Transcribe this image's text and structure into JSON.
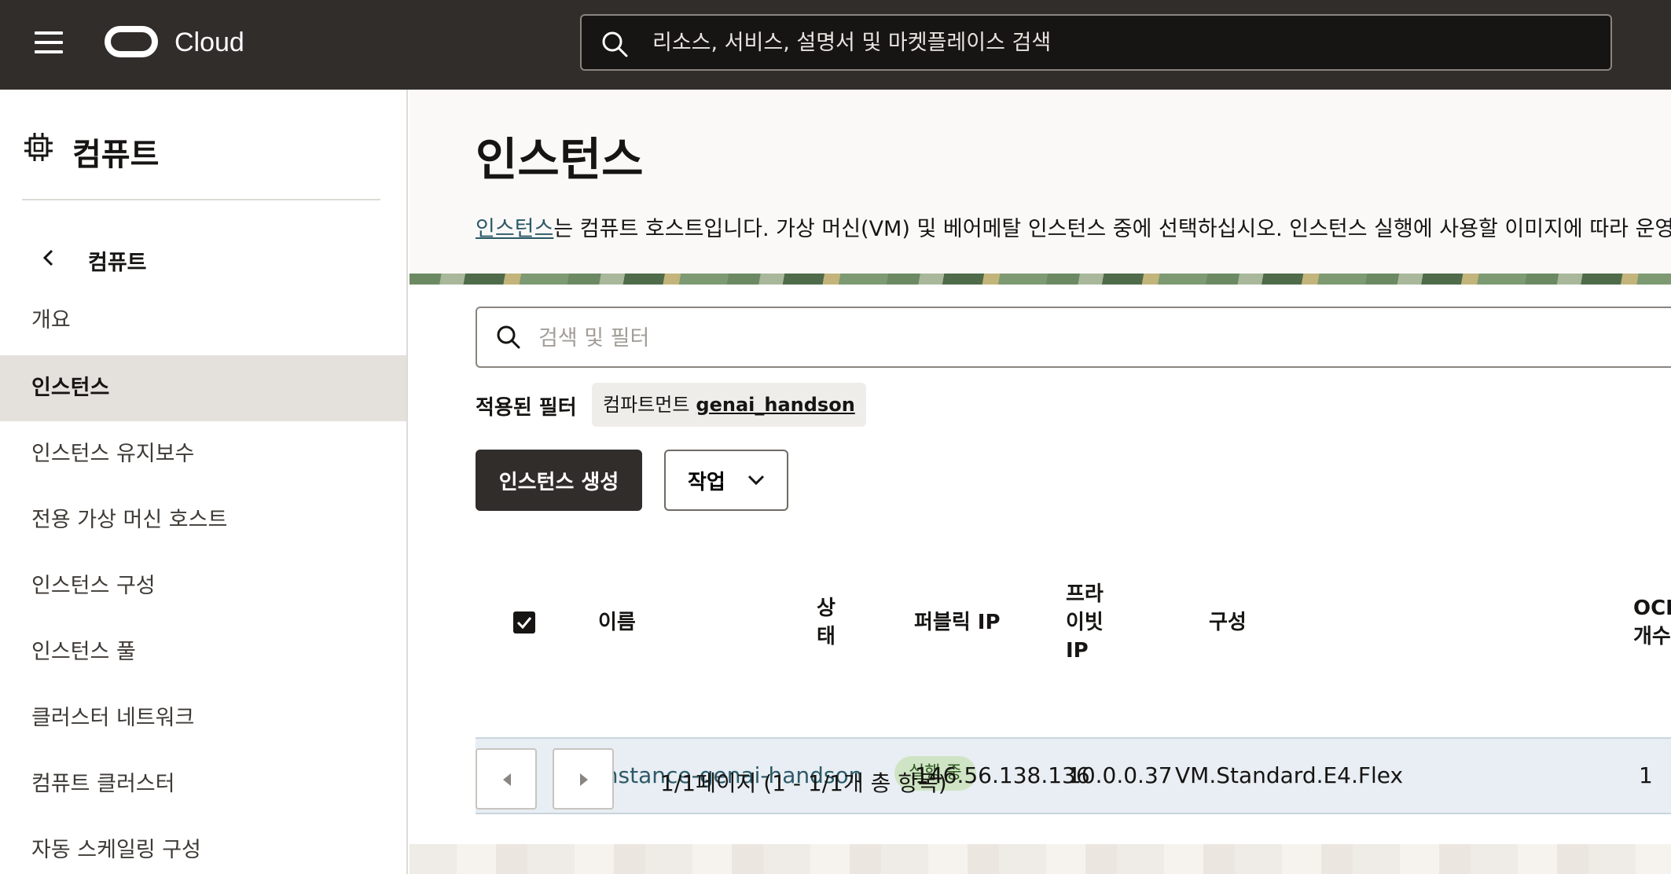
{
  "topbar": {
    "brand": "Cloud",
    "search_placeholder": "리소스, 서비스, 설명서 및 마켓플레이스 검색"
  },
  "sidebar": {
    "title": "컴퓨트",
    "back_label": "컴퓨트",
    "items": [
      {
        "label": "개요",
        "active": false
      },
      {
        "label": "인스턴스",
        "active": true
      },
      {
        "label": "인스턴스 유지보수",
        "active": false
      },
      {
        "label": "전용 가상 머신 호스트",
        "active": false
      },
      {
        "label": "인스턴스 구성",
        "active": false
      },
      {
        "label": "인스턴스 풀",
        "active": false
      },
      {
        "label": "클러스터 네트워크",
        "active": false
      },
      {
        "label": "컴퓨트 클러스터",
        "active": false
      },
      {
        "label": "자동 스케일링 구성",
        "active": false
      }
    ]
  },
  "main": {
    "title": "인스턴스",
    "description_link": "인스턴스",
    "description_rest": "는 컴퓨트 호스트입니다. 가상 머신(VM) 및 베어메탈 인스턴스 중에 선택하십시오. 인스턴스 실행에 사용할 이미지에 따라 운영체제 및",
    "filter_placeholder": "검색 및 필터",
    "applied_filters_label": "적용된 필터",
    "chip_key": "컴파트먼트",
    "chip_value": "genai_handson",
    "create_button": "인스턴스 생성",
    "actions_button": "작업"
  },
  "table": {
    "headers": {
      "name": "이름",
      "state_1": "상",
      "state_2": "태",
      "public_ip": "퍼블릭 IP",
      "private_1": "프라",
      "private_2": "이빗",
      "private_3": "IP",
      "shape": "구성",
      "ocpu_1": "OCPU",
      "ocpu_2": "개수"
    },
    "rows": [
      {
        "name": "instance-genai-handson",
        "state": "실행 중",
        "public_ip": "146.56.138.136",
        "private_ip": "10.0.0.37",
        "shape": "VM.Standard.E4.Flex",
        "ocpu": "1",
        "selected": true
      }
    ],
    "pagination": "1/1페이지 (1 - 1/1개 총 항목)"
  },
  "colors": {
    "topbar": "#312d2a",
    "link": "#2c5967",
    "status_badge_bg": "#cfe4c4",
    "selected_row": "#e8eef3"
  }
}
